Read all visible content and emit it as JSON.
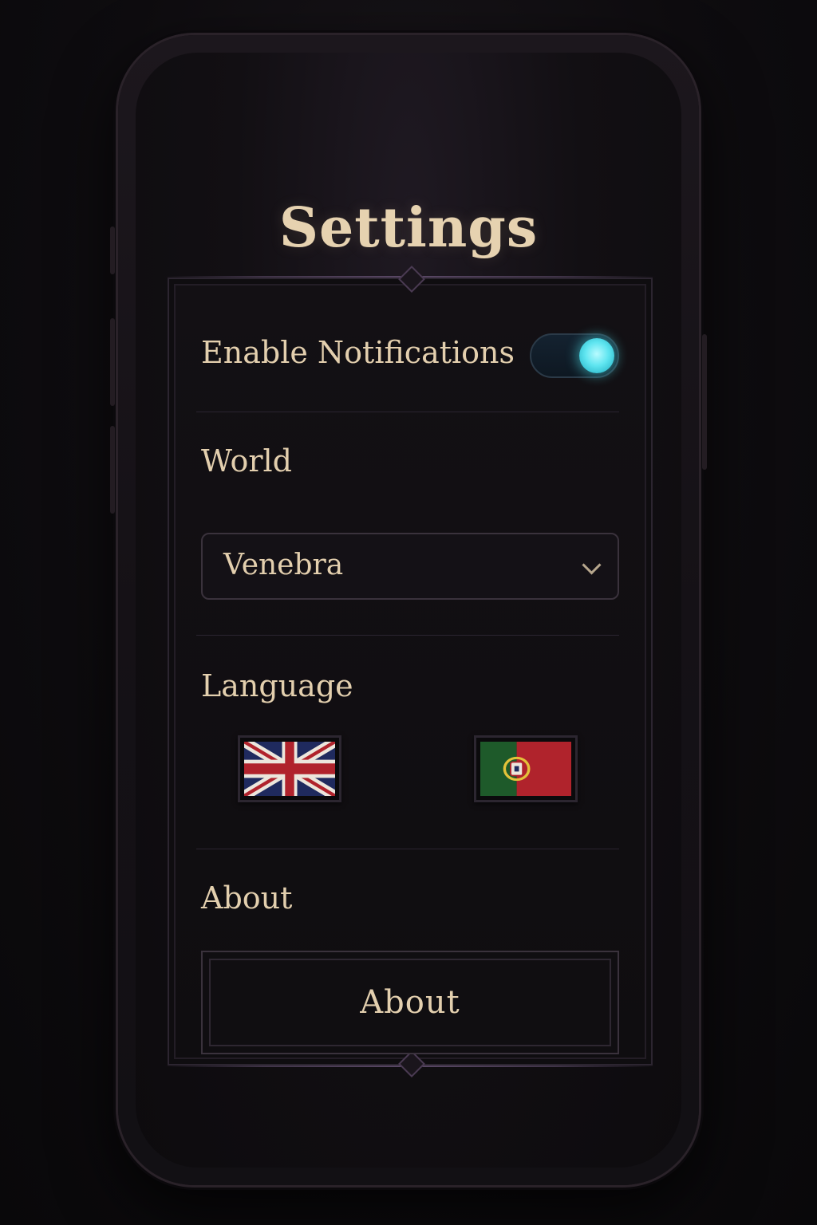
{
  "screen": {
    "title": "Settings"
  },
  "notifications": {
    "label": "Enable Notifications",
    "enabled": true,
    "accent_color": "#5fe5f0"
  },
  "world": {
    "label": "World",
    "selected": "Venebra",
    "icon": "chevron-down-icon"
  },
  "language": {
    "label": "Language",
    "options": [
      {
        "name": "English",
        "icon": "uk-flag-icon"
      },
      {
        "name": "Portuguese",
        "icon": "portugal-flag-icon"
      }
    ]
  },
  "about": {
    "label": "About",
    "button_label": "About"
  },
  "colors": {
    "text": "#e3cfae",
    "background": "#0d0b0e"
  }
}
